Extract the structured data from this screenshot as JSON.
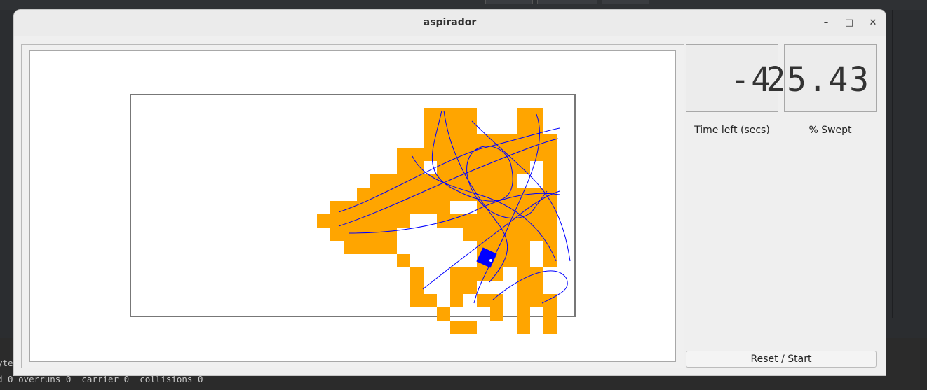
{
  "window": {
    "title": "aspirador"
  },
  "controls": {
    "minimize": "–",
    "maximize": "□",
    "close": "✕"
  },
  "lcds": {
    "time_left": {
      "value": "-4",
      "label": "Time left (secs)"
    },
    "swept": {
      "value": "25.43",
      "label": "% Swept"
    }
  },
  "button": {
    "reset_label": "Reset / Start"
  },
  "terminal": {
    "line1": "yte",
    "line2": "d 0 overruns 0  carrier 0  collisions 0"
  },
  "colors": {
    "swept_cell": "#ffa500",
    "robot": "#0000ff",
    "path": "#0000ff"
  }
}
